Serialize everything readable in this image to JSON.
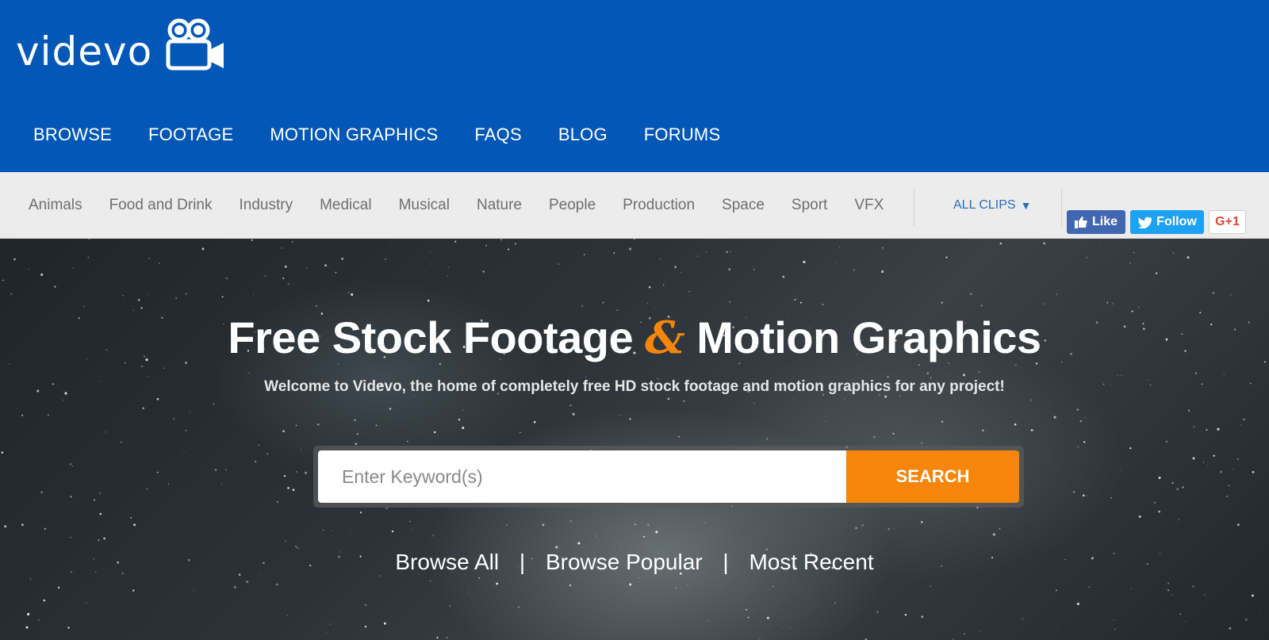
{
  "brand": {
    "logo_text": "videvo",
    "logo_icon": "camera-icon",
    "color": "#0357b6"
  },
  "main_nav": [
    "BROWSE",
    "FOOTAGE",
    "MOTION GRAPHICS",
    "FAQS",
    "BLOG",
    "FORUMS"
  ],
  "categories": [
    "Animals",
    "Food and Drink",
    "Industry",
    "Medical",
    "Musical",
    "Nature",
    "People",
    "Production",
    "Space",
    "Sport",
    "VFX"
  ],
  "filter": {
    "label": "ALL CLIPS",
    "icon": "caret-down-icon"
  },
  "social": {
    "facebook": {
      "label": "Like",
      "icon": "thumbs-up-icon",
      "color": "#4267b2"
    },
    "twitter": {
      "label": "Follow",
      "icon": "twitter-bird-icon",
      "color": "#1da1f2"
    },
    "google_plus": {
      "label": "G+1",
      "color": "#dd4b39"
    }
  },
  "hero": {
    "title_part1": "Free Stock Footage",
    "title_amp": "&",
    "title_part2": "Motion Graphics",
    "subtitle": "Welcome to Videvo, the home of completely free HD stock footage and motion graphics for any project!",
    "accent_color": "#f5860b"
  },
  "search": {
    "placeholder": "Enter Keyword(s)",
    "value": "",
    "button_label": "SEARCH"
  },
  "browse_links": [
    "Browse All",
    "Browse Popular",
    "Most Recent"
  ],
  "browse_separator": "|"
}
